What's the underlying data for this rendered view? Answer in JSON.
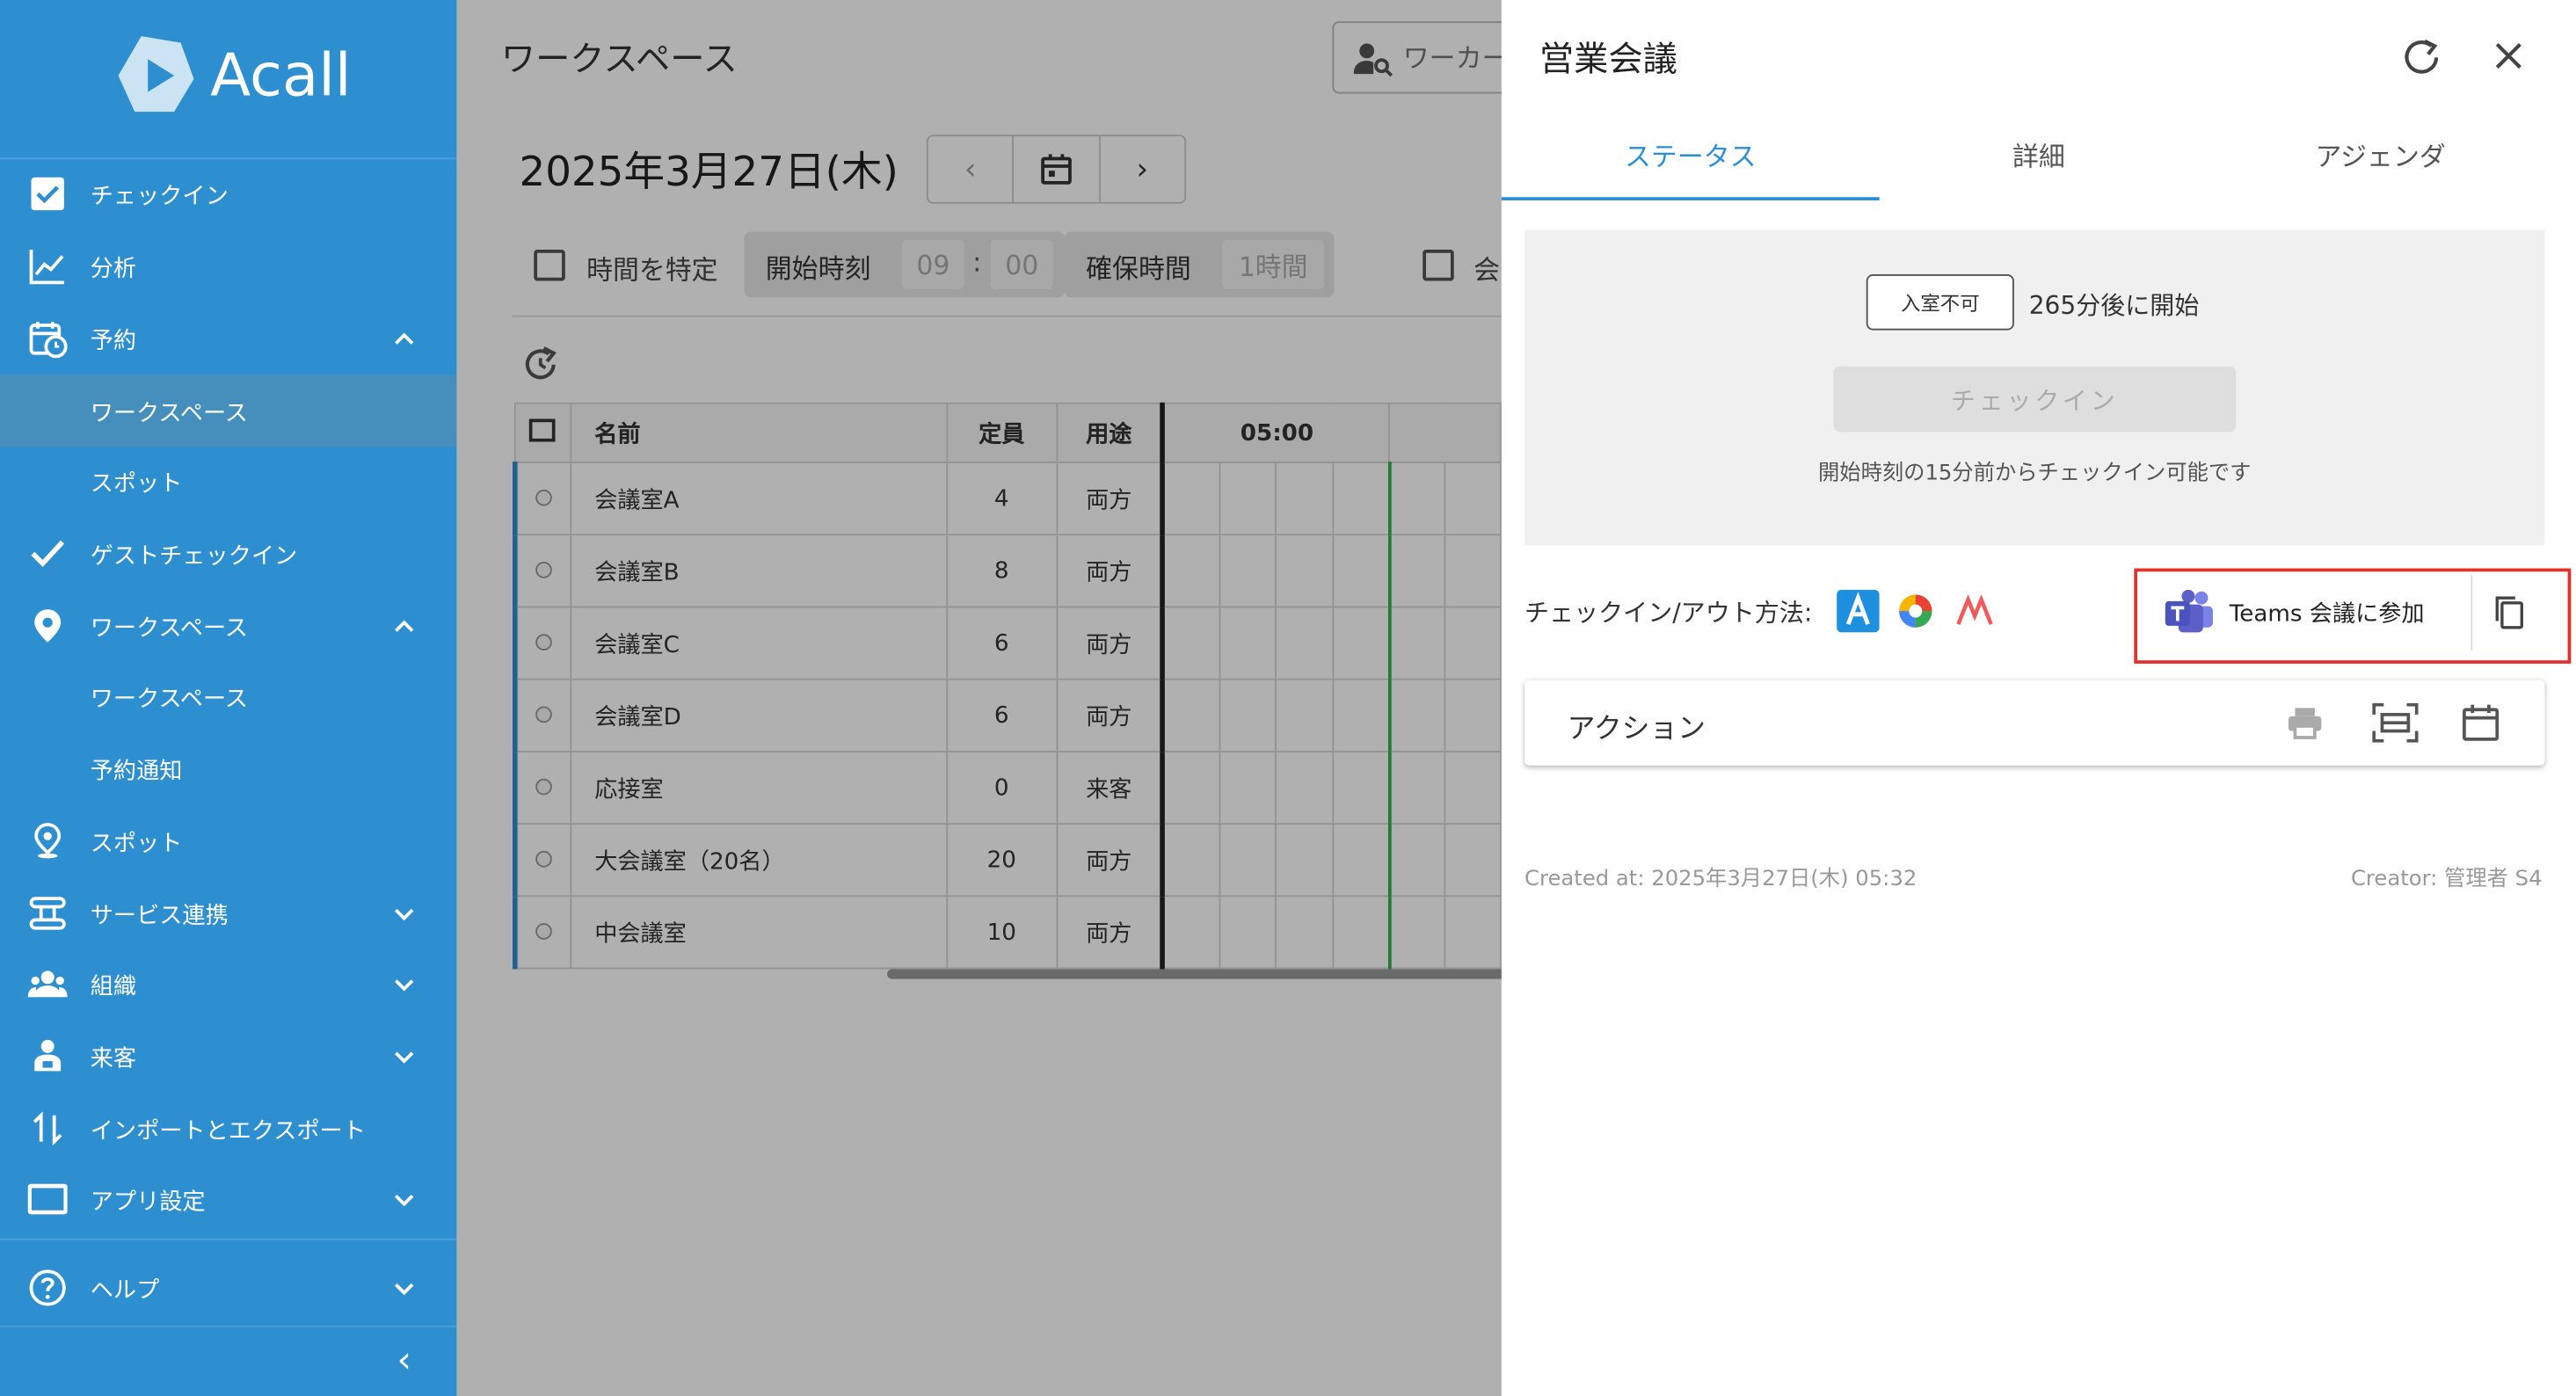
{
  "sidebar": {
    "brand": "Acall",
    "items": [
      {
        "label": "チェックイン"
      },
      {
        "label": "分析"
      },
      {
        "label": "予約"
      },
      {
        "label": "ワークスペース"
      },
      {
        "label": "スポット"
      },
      {
        "label": "ゲストチェックイン"
      },
      {
        "label": "ワークスペース"
      },
      {
        "label": "ワークスペース"
      },
      {
        "label": "予約通知"
      },
      {
        "label": "スポット"
      },
      {
        "label": "サービス連携"
      },
      {
        "label": "組織"
      },
      {
        "label": "来客"
      },
      {
        "label": "インポートとエクスポート"
      },
      {
        "label": "アプリ設定"
      },
      {
        "label": "ヘルプ"
      }
    ],
    "collapse_glyph": "‹",
    "colors": {
      "background": "#2e8fd0",
      "active": "#468fbd"
    }
  },
  "main": {
    "title": "ワークスペース",
    "search_placeholder": "ワーカー",
    "date": "2025年3月27日(木)",
    "nav": {
      "prev": "‹",
      "next": "›"
    },
    "filters": {
      "specify_time": "時間を特定",
      "start_time_label": "開始時刻",
      "hour": "09",
      "colon": ":",
      "minute": "00",
      "duration_label": "確保時間",
      "duration_value": "1時間",
      "extra_label": "会"
    },
    "table": {
      "headers": {
        "name": "名前",
        "capacity": "定員",
        "usage": "用途",
        "time": "05:00"
      },
      "rows": [
        {
          "name": "会議室A",
          "capacity": "4",
          "usage": "両方"
        },
        {
          "name": "会議室B",
          "capacity": "8",
          "usage": "両方"
        },
        {
          "name": "会議室C",
          "capacity": "6",
          "usage": "両方"
        },
        {
          "name": "会議室D",
          "capacity": "6",
          "usage": "両方"
        },
        {
          "name": "応接室",
          "capacity": "0",
          "usage": "来客"
        },
        {
          "name": "大会議室（20名）",
          "capacity": "20",
          "usage": "両方"
        },
        {
          "name": "中会議室",
          "capacity": "10",
          "usage": "両方"
        }
      ]
    }
  },
  "panel": {
    "title": "営業会議",
    "tabs": [
      "ステータス",
      "詳細",
      "アジェンダ"
    ],
    "status": {
      "badge": "入室不可",
      "starts_in": "265分後に開始",
      "checkin_button": "チェックイン",
      "hint": "開始時刻の15分前からチェックイン可能です"
    },
    "method_label": "チェックイン/アウト方法:",
    "teams_button": "Teams 会議に参加",
    "action_label": "アクション",
    "created": "Created at: 2025年3月27日(木) 05:32",
    "creator": "Creator: 管理者 S4",
    "colors": {
      "accent": "#2a8fd6",
      "highlight_border": "#e6302a",
      "teams": "#5b5fc7"
    }
  }
}
